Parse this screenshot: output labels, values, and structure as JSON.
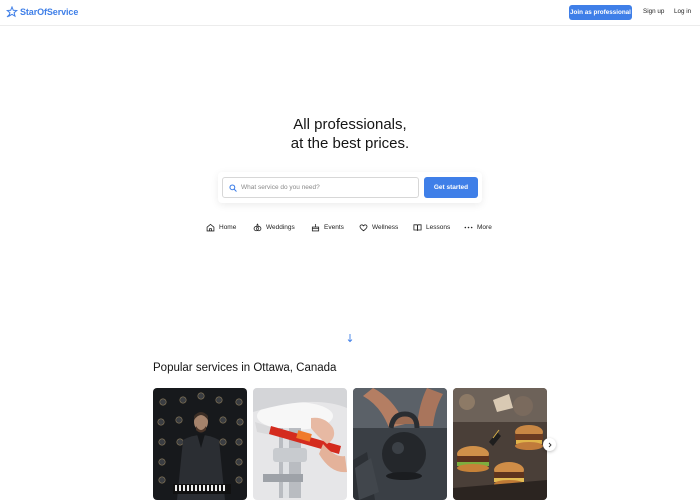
{
  "header": {
    "logo_text": "StarOfService",
    "join_label": "Join as professional",
    "signup_label": "Sign up",
    "login_label": "Log in"
  },
  "hero": {
    "title_line1": "All professionals,",
    "title_line2": "at the best prices."
  },
  "search": {
    "placeholder": "What service do you need?",
    "button_label": "Get started"
  },
  "categories": [
    {
      "label": "Home",
      "icon": "home-icon"
    },
    {
      "label": "Weddings",
      "icon": "rings-icon"
    },
    {
      "label": "Events",
      "icon": "cake-icon"
    },
    {
      "label": "Wellness",
      "icon": "heart-icon"
    },
    {
      "label": "Lessons",
      "icon": "book-icon"
    },
    {
      "label": "More",
      "icon": "more-dots-icon"
    }
  ],
  "popular": {
    "title": "Popular services in Ottawa, Canada",
    "cards": [
      {
        "image": "dj-photo"
      },
      {
        "image": "plumbing-photo"
      },
      {
        "image": "kettlebell-photo"
      },
      {
        "image": "burgers-photo"
      }
    ]
  },
  "colors": {
    "brand": "#3f7fe8",
    "text": "#151515"
  }
}
